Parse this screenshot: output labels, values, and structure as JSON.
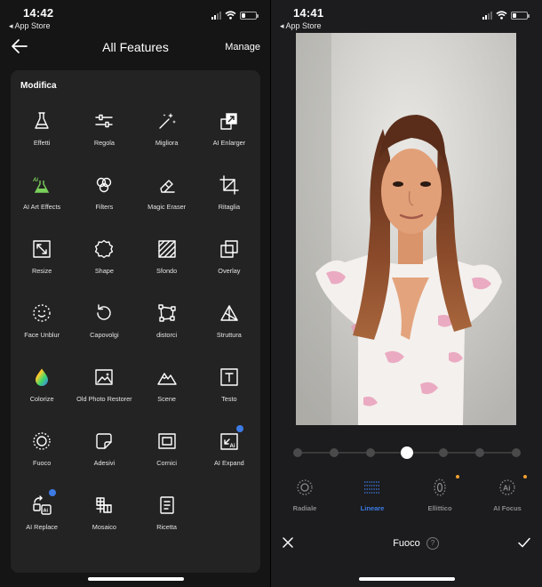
{
  "left": {
    "status": {
      "time": "14:42",
      "back_app": "◂ App Store"
    },
    "header": {
      "title": "All Features",
      "manage_label": "Manage"
    },
    "section_title": "Modifica",
    "features": [
      {
        "label": "Effetti",
        "icon": "flask-icon"
      },
      {
        "label": "Regola",
        "icon": "sliders-icon"
      },
      {
        "label": "Migliora",
        "icon": "magic-wand-icon"
      },
      {
        "label": "AI Enlarger",
        "icon": "enlarge-icon"
      },
      {
        "label": "AI Art Effects",
        "icon": "ai-flask-icon"
      },
      {
        "label": "Filters",
        "icon": "filters-icon"
      },
      {
        "label": "Magic Eraser",
        "icon": "eraser-icon"
      },
      {
        "label": "Ritaglia",
        "icon": "crop-icon"
      },
      {
        "label": "Resize",
        "icon": "resize-icon"
      },
      {
        "label": "Shape",
        "icon": "shape-icon"
      },
      {
        "label": "Sfondo",
        "icon": "background-icon"
      },
      {
        "label": "Overlay",
        "icon": "overlay-icon"
      },
      {
        "label": "Face Unblur",
        "icon": "face-icon"
      },
      {
        "label": "Capovolgi",
        "icon": "rotate-icon"
      },
      {
        "label": "distorci",
        "icon": "distort-icon"
      },
      {
        "label": "Struttura",
        "icon": "structure-icon"
      },
      {
        "label": "Colorize",
        "icon": "colorize-drop-icon"
      },
      {
        "label": "Old Photo Restorer",
        "icon": "photo-restore-icon"
      },
      {
        "label": "Scene",
        "icon": "mountain-icon"
      },
      {
        "label": "Testo",
        "icon": "text-icon"
      },
      {
        "label": "Fuoco",
        "icon": "focus-icon"
      },
      {
        "label": "Adesivi",
        "icon": "sticker-icon"
      },
      {
        "label": "Cornici",
        "icon": "frame-icon"
      },
      {
        "label": "AI Expand",
        "icon": "ai-expand-icon"
      },
      {
        "label": "AI Replace",
        "icon": "ai-replace-icon"
      },
      {
        "label": "Mosaico",
        "icon": "mosaic-icon"
      },
      {
        "label": "Ricetta",
        "icon": "recipe-icon"
      }
    ]
  },
  "right": {
    "status": {
      "time": "14:41",
      "back_app": "◂ App Store"
    },
    "slider": {
      "stop_count": 7,
      "active_index": 3
    },
    "modes": [
      {
        "label": "Radiale",
        "icon": "radial-icon",
        "active": false,
        "new_dot": false
      },
      {
        "label": "Lineare",
        "icon": "linear-icon",
        "active": true,
        "new_dot": false
      },
      {
        "label": "Ellittico",
        "icon": "elliptical-icon",
        "active": false,
        "new_dot": true
      },
      {
        "label": "AI Focus",
        "icon": "ai-focus-icon",
        "active": false,
        "new_dot": true
      }
    ],
    "bottom": {
      "title": "Fuoco",
      "help": "?"
    }
  },
  "colors": {
    "accent": "#3d7be5",
    "new_dot": "#f0a030",
    "panel": "#232323",
    "background": "#151515"
  }
}
